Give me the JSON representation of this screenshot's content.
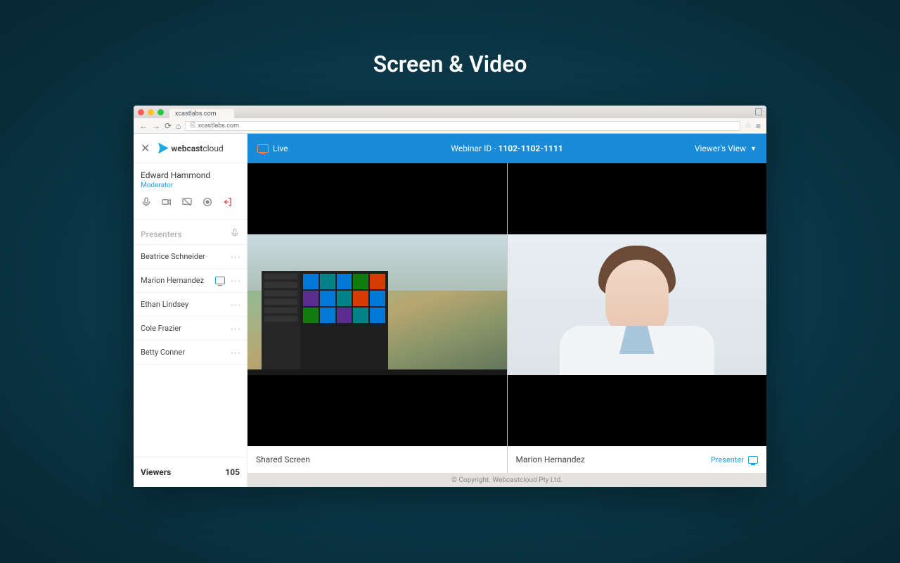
{
  "page_heading": "Screen & Video",
  "browser": {
    "tab_title": "xcastlabs.com",
    "url": "xcastlabs.com"
  },
  "logo": {
    "bold": "webcast",
    "light": "cloud"
  },
  "user": {
    "name": "Edward Hammond",
    "role": "Moderator"
  },
  "sidebar": {
    "presenters_label": "Presenters",
    "presenters": [
      {
        "name": "Beatrice Schneider",
        "sharing": false
      },
      {
        "name": "Marion Hernandez",
        "sharing": true
      },
      {
        "name": "Ethan Lindsey",
        "sharing": false
      },
      {
        "name": "Cole Frazier",
        "sharing": false
      },
      {
        "name": "Betty Conner",
        "sharing": false
      }
    ],
    "viewers_label": "Viewers",
    "viewers_count": "105"
  },
  "topbar": {
    "live_label": "Live",
    "webinar_id_label": "Webinar ID - ",
    "webinar_id": "1102-1102-1111",
    "view_label": "Viewer's View"
  },
  "panes": {
    "left_caption": "Shared Screen",
    "right_caption": "Marion Hernandez",
    "right_badge": "Presenter"
  },
  "footer": "© Copyright. Webcastcloud Pty Ltd."
}
